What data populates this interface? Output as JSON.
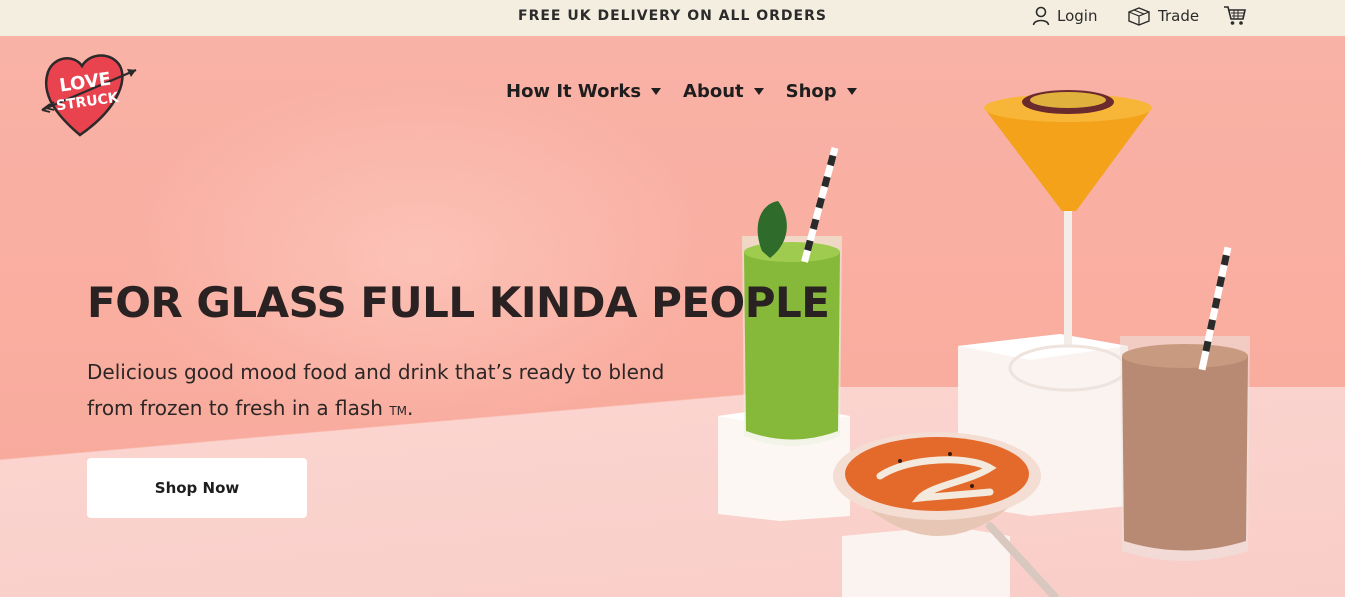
{
  "topbar": {
    "promo": "FREE UK DELIVERY ON ALL ORDERS",
    "login_label": "Login",
    "trade_label": "Trade"
  },
  "logo": {
    "text_line1": "LOVE",
    "text_line2": "STRUCK"
  },
  "nav": {
    "items": [
      {
        "label": "How It Works"
      },
      {
        "label": "About"
      },
      {
        "label": "Shop"
      }
    ]
  },
  "hero": {
    "headline": "FOR GLASS FULL KINDA PEOPLE",
    "subtitle": "Delicious good mood food and drink that’s ready to blend from frozen to fresh in a flash",
    "trademark": "TM",
    "cta_label": "Shop Now"
  },
  "colors": {
    "hero_bg": "#f9b2a6",
    "topbar_bg": "#f4eee0",
    "logo_red": "#e8434f"
  },
  "icons": [
    "user-icon",
    "trade-box-icon",
    "cart-icon",
    "caret-down-icon"
  ]
}
